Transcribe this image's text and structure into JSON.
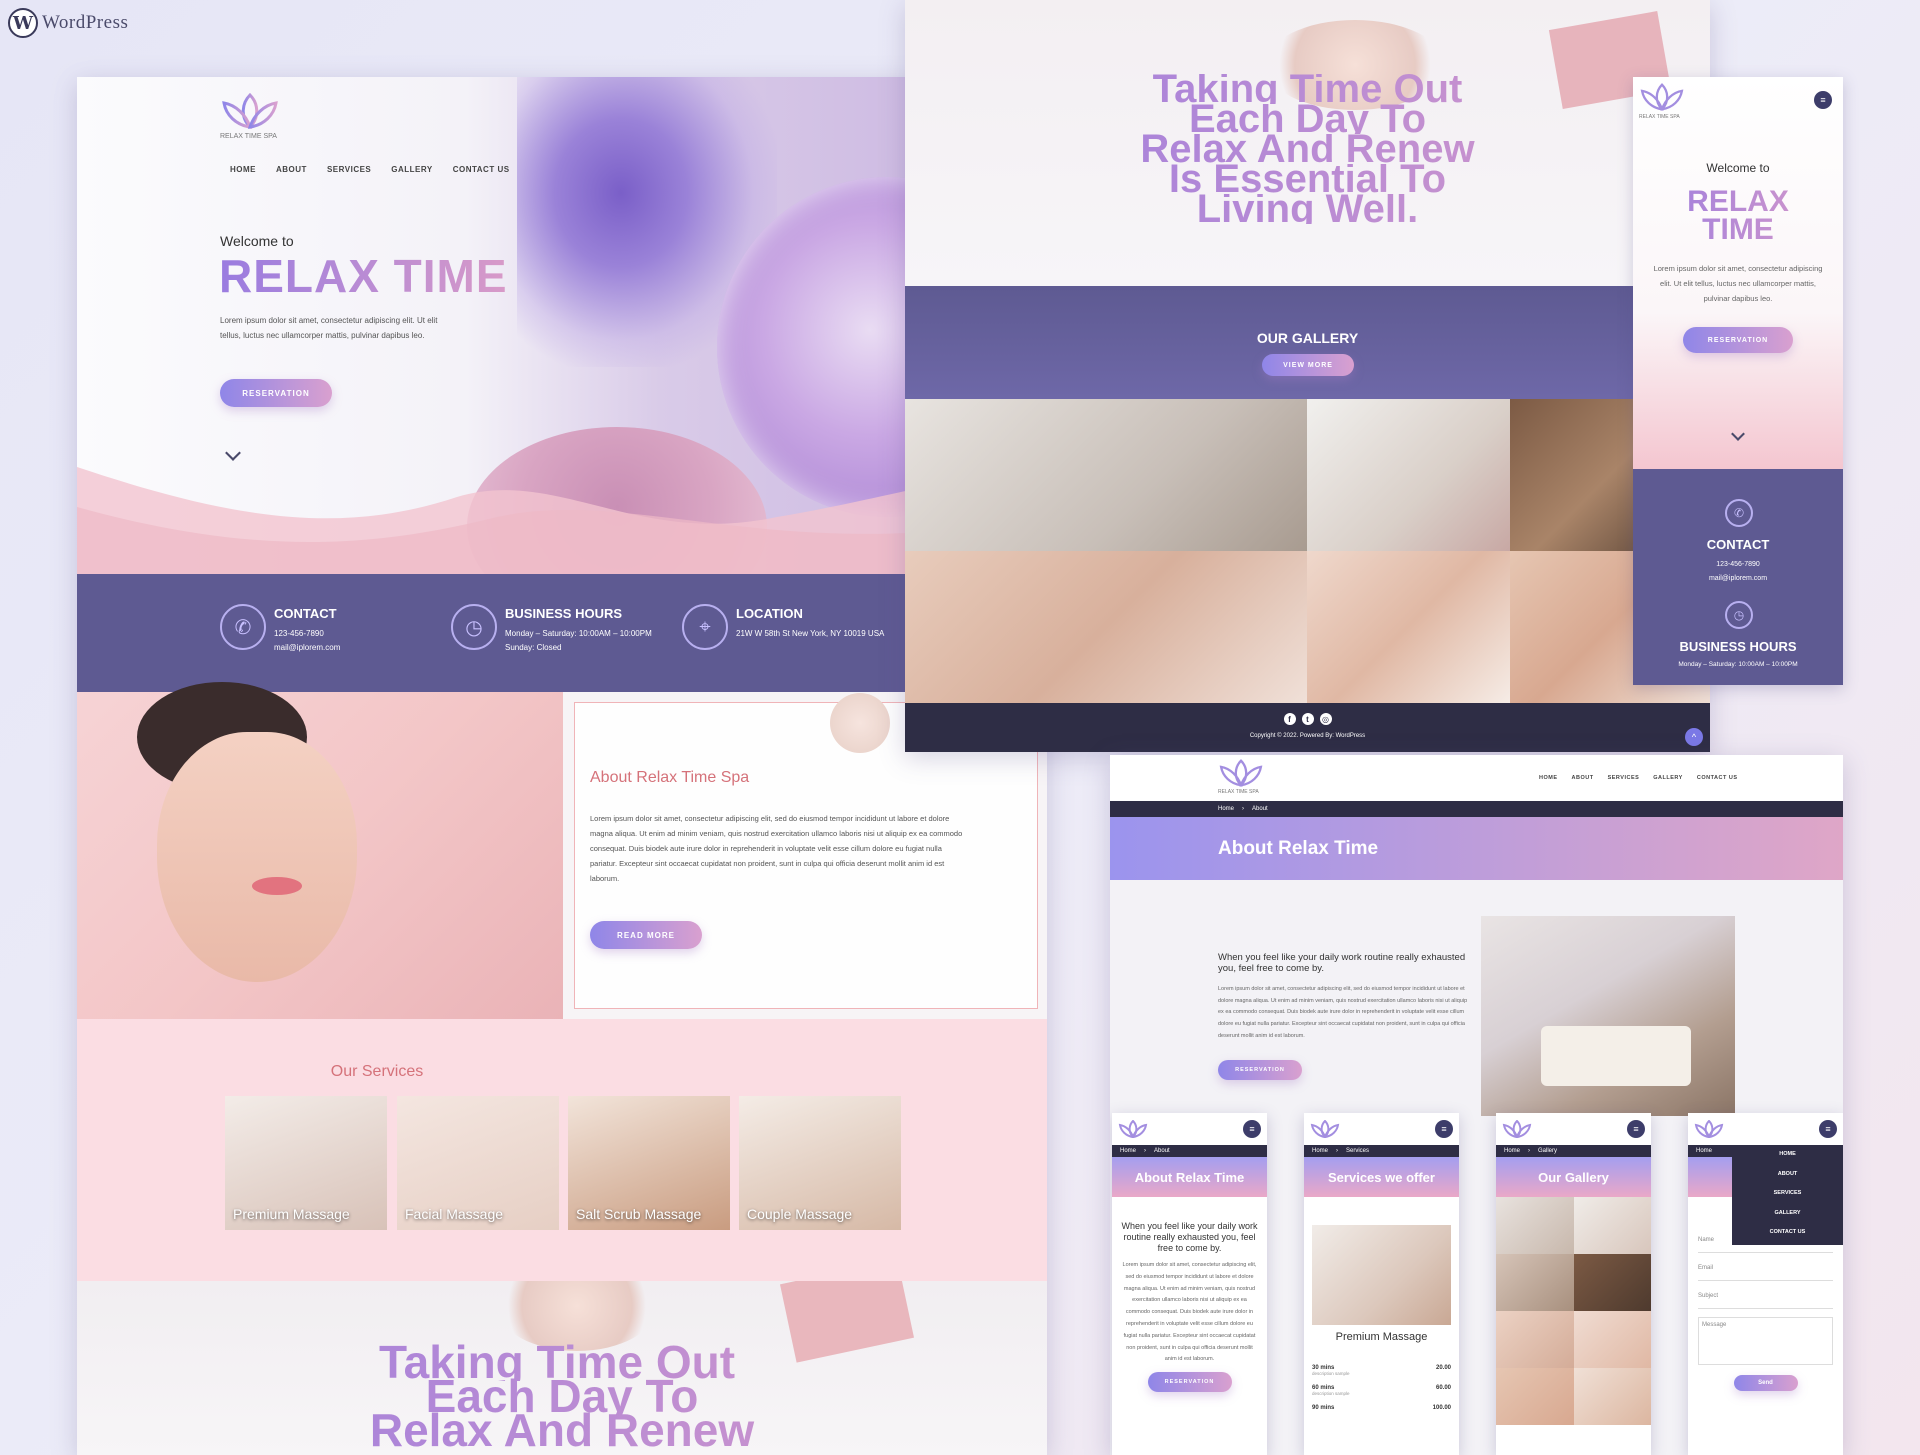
{
  "brand": {
    "wp_mark": "W",
    "wp_name": "WordPress",
    "spa_name": "RELAX TIME SPA"
  },
  "nav": [
    "HOME",
    "ABOUT",
    "SERVICES",
    "GALLERY",
    "CONTACT US"
  ],
  "hero": {
    "welcome": "Welcome to",
    "title": "RELAX TIME",
    "body": "Lorem ipsum dolor sit amet, consectetur adipiscing elit. Ut elit tellus, luctus nec ullamcorper mattis, pulvinar dapibus leo.",
    "button": "RESERVATION"
  },
  "info": {
    "contact": {
      "title": "CONTACT",
      "phone": "123-456-7890",
      "email": "mail@iplorem.com"
    },
    "hours": {
      "title": "BUSINESS HOURS",
      "line1": "Monday – Saturday: 10:00AM – 10:00PM",
      "line2": "Sunday: Closed"
    },
    "location": {
      "title": "LOCATION",
      "address": "21W W 58th St New York, NY 10019 USA"
    }
  },
  "about": {
    "title": "About Relax Time Spa",
    "body": "Lorem ipsum dolor sit amet, consectetur adipiscing elit, sed do eiusmod tempor incididunt ut labore et dolore magna aliqua. Ut enim ad minim veniam, quis nostrud exercitation ullamco laboris nisi ut aliquip ex ea commodo consequat. Duis biodek aute irure dolor in reprehenderit in voluptate velit esse cillum dolore eu fugiat nulla pariatur. Excepteur sint occaecat cupidatat non proident, sunt in culpa qui officia deserunt mollit anim id est laborum.",
    "button": "READ MORE"
  },
  "services": {
    "title": "Our Services",
    "items": [
      "Premium Massage",
      "Facial Massage",
      "Salt Scrub Massage",
      "Couple Massage"
    ]
  },
  "quote": {
    "line1": "Taking Time Out",
    "line2": "Each Day To",
    "line3": "Relax And Renew",
    "line4": "Is Essential To",
    "line5": "Living Well."
  },
  "gallery": {
    "title": "OUR GALLERY",
    "button": "VIEW MORE"
  },
  "footer": {
    "copyright": "Copyright © 2022. Powered By: WordPress",
    "social": [
      "f",
      "t",
      "◎"
    ]
  },
  "about_page": {
    "crumb_home": "Home",
    "crumb_current": "About",
    "title": "About Relax Time",
    "lead": "When you feel like your daily work routine really exhausted you, feel free to come by.",
    "body": "Lorem ipsum dolor sit amet, consectetur adipiscing elit, sed do eiusmod tempor incididunt ut labore et dolore magna aliqua. Ut enim ad minim veniam, quis nostrud exercitation ullamco laboris nisi ut aliquip ex ea commodo consequat. Duis biodek aute irure dolor in reprehenderit in voluptate velit esse cillum dolore eu fugiat nulla pariatur. Excepteur sint occaecat cupidatat non proident, sunt in culpa qui officia deserunt mollit anim id est laborum.",
    "button": "RESERVATION"
  },
  "mobile": {
    "about_title": "About Relax Time",
    "services_crumb": "Services",
    "services_title": "Services we offer",
    "service_name": "Premium Massage",
    "prices": [
      {
        "label": "30 mins",
        "desc": "description sample",
        "price": "20.00"
      },
      {
        "label": "60 mins",
        "desc": "description sample",
        "price": "60.00"
      },
      {
        "label": "90 mins",
        "desc": "description sample",
        "price": "100.00"
      }
    ],
    "gallery_crumb": "Gallery",
    "gallery_title": "Our Gallery",
    "menu": [
      "HOME",
      "ABOUT",
      "SERVICES",
      "GALLERY",
      "CONTACT US"
    ],
    "form": {
      "name": "Name",
      "email": "Email",
      "subject": "Subject",
      "message": "Message",
      "send": "Send"
    }
  },
  "mobile_home": {
    "title_line1": "RELAX",
    "title_line2": "TIME"
  },
  "colors": {
    "accent_purple": "#5e5a92",
    "gradient_start": "#8f86e8",
    "gradient_end": "#d9a0cf",
    "pink_bg": "#fbdde3",
    "dark_footer": "#2e2d45",
    "heading_pink": "#d5727a"
  }
}
